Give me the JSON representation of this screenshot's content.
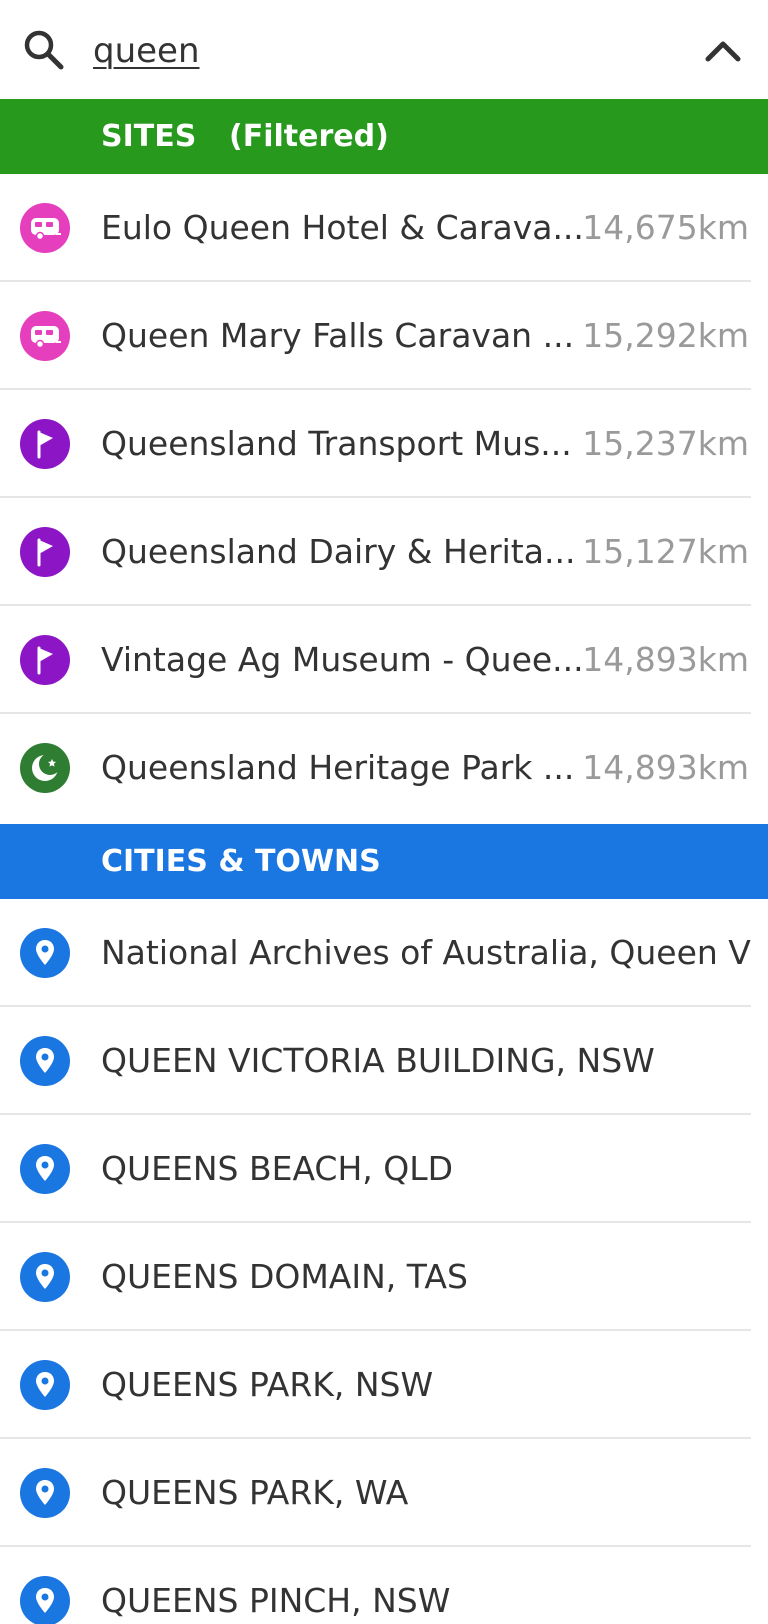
{
  "search": {
    "value": "queen"
  },
  "sites": {
    "title": "SITES",
    "filter_label": "(Filtered)",
    "color": "#279a1d",
    "items": [
      {
        "name": "Eulo Queen Hotel & Carava...",
        "distance": "14,675km",
        "icon": "caravan-icon",
        "icon_color": "#e63fbe"
      },
      {
        "name": "Queen Mary Falls Caravan ...",
        "distance": "15,292km",
        "icon": "caravan-icon",
        "icon_color": "#e63fbe"
      },
      {
        "name": "Queensland Transport Mus...",
        "distance": "15,237km",
        "icon": "flag-icon",
        "icon_color": "#8c16c6"
      },
      {
        "name": "Queensland Dairy & Herita...",
        "distance": "15,127km",
        "icon": "flag-icon",
        "icon_color": "#8c16c6"
      },
      {
        "name": "Vintage Ag Museum - Quee...",
        "distance": "14,893km",
        "icon": "flag-icon",
        "icon_color": "#8c16c6"
      },
      {
        "name": "Queensland Heritage Park ...",
        "distance": "14,893km",
        "icon": "moon-icon",
        "icon_color": "#2e7d32"
      }
    ]
  },
  "cities": {
    "title": "CITIES & TOWNS",
    "color": "#1a76e0",
    "items": [
      {
        "name": "National Archives of Australia, Queen Vi...",
        "icon": "location-pin-icon",
        "icon_color": "#1a76e0"
      },
      {
        "name": "QUEEN VICTORIA BUILDING, NSW",
        "icon": "location-pin-icon",
        "icon_color": "#1a76e0"
      },
      {
        "name": "QUEENS BEACH, QLD",
        "icon": "location-pin-icon",
        "icon_color": "#1a76e0"
      },
      {
        "name": "QUEENS DOMAIN, TAS",
        "icon": "location-pin-icon",
        "icon_color": "#1a76e0"
      },
      {
        "name": "QUEENS PARK, NSW",
        "icon": "location-pin-icon",
        "icon_color": "#1a76e0"
      },
      {
        "name": "QUEENS PARK, WA",
        "icon": "location-pin-icon",
        "icon_color": "#1a76e0"
      },
      {
        "name": "QUEENS PINCH, NSW",
        "icon": "location-pin-icon",
        "icon_color": "#1a76e0"
      }
    ]
  }
}
